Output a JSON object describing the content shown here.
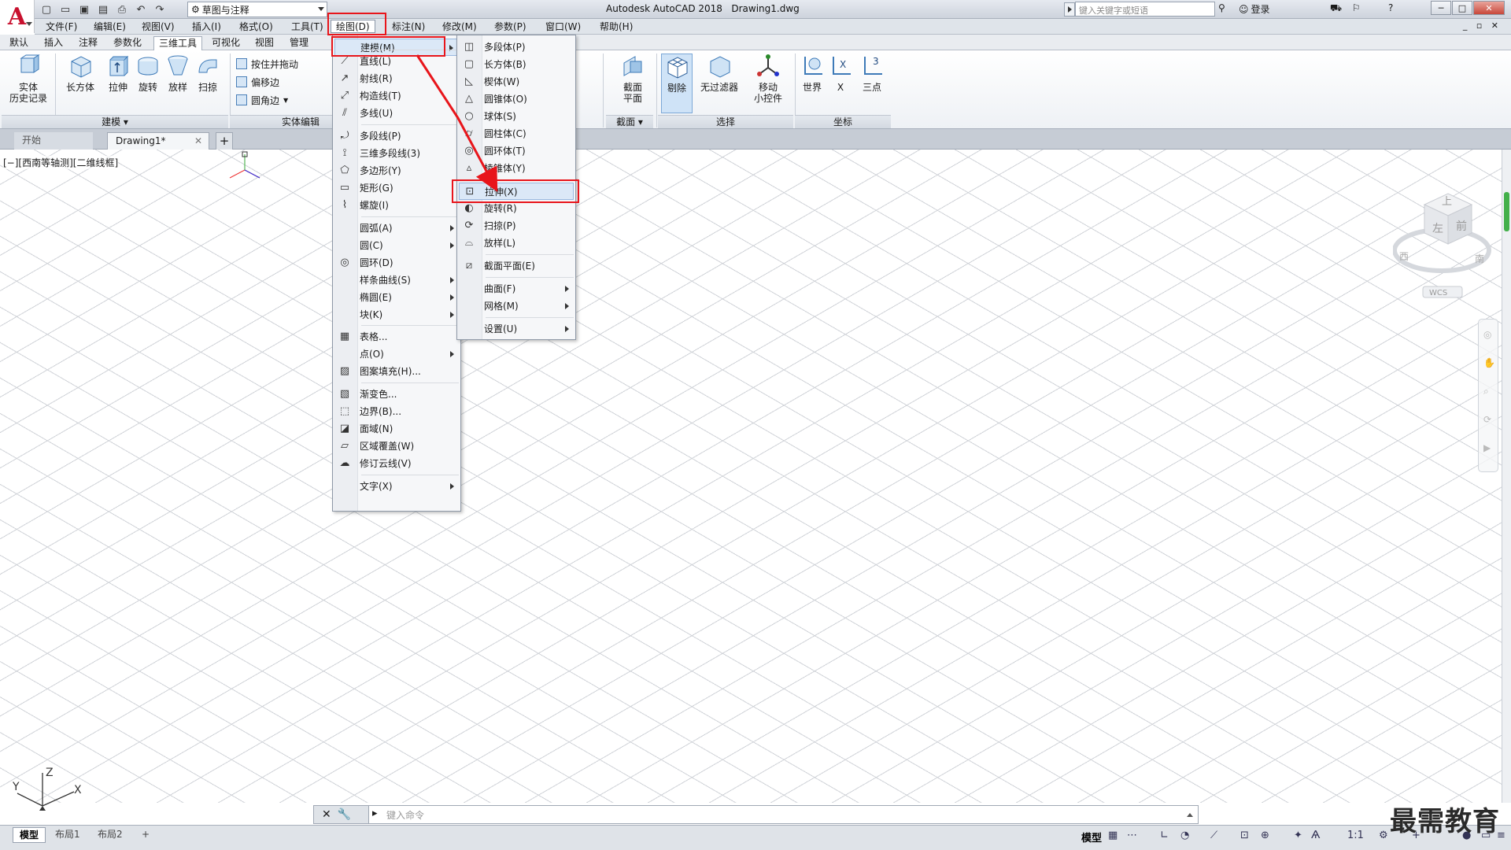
{
  "window": {
    "title": "Autodesk AutoCAD 2018",
    "filename": "Drawing1.dwg"
  },
  "workspace": {
    "selected": "草图与注释"
  },
  "search": {
    "placeholder": "键入关键字或短语"
  },
  "signin": {
    "label": "登录"
  },
  "menubar": [
    "文件(F)",
    "编辑(E)",
    "视图(V)",
    "插入(I)",
    "格式(O)",
    "工具(T)",
    "绘图(D)",
    "标注(N)",
    "修改(M)",
    "参数(P)",
    "窗口(W)",
    "帮助(H)"
  ],
  "ribbon_tabs": [
    "默认",
    "插入",
    "注释",
    "参数化",
    "三维工具",
    "可视化",
    "视图",
    "管理"
  ],
  "ribbon": {
    "history": "实体\n历史记录",
    "modeling": [
      "长方体",
      "拉伸",
      "旋转",
      "放样",
      "扫掠"
    ],
    "solid_edit_small": [
      "按住并拖动",
      "偏移边",
      "圆角边"
    ],
    "panel_modeling": "建模",
    "panel_solid_edit": "实体编辑",
    "section_plane": "截面\n平面",
    "panel_section": "截面",
    "select": [
      "剔除",
      "无过滤器",
      "移动\n小控件"
    ],
    "panel_select": "选择",
    "coords": [
      "世界",
      "X",
      "三点"
    ],
    "panel_coords": "坐标"
  },
  "file_tabs": {
    "start": "开始",
    "drawing": "Drawing1*",
    "plus": "+"
  },
  "viewport_label": "[−][西南等轴测][二维线框]",
  "draw_menu": {
    "items": [
      {
        "label": "建模(M)",
        "icon": "",
        "sub": true
      },
      {
        "label": "直线(L)",
        "icon": "line-icon"
      },
      {
        "label": "射线(R)",
        "icon": "ray-icon"
      },
      {
        "label": "构造线(T)",
        "icon": "xline-icon"
      },
      {
        "label": "多线(U)",
        "icon": "mline-icon"
      },
      {
        "label": "多段线(P)",
        "icon": "polyline-icon"
      },
      {
        "label": "三维多段线(3)",
        "icon": "3dpoly-icon"
      },
      {
        "label": "多边形(Y)",
        "icon": "polygon-icon"
      },
      {
        "label": "矩形(G)",
        "icon": "rectangle-icon"
      },
      {
        "label": "螺旋(I)",
        "icon": "helix-icon"
      },
      {
        "label": "圆弧(A)",
        "icon": "",
        "sub": true
      },
      {
        "label": "圆(C)",
        "icon": "",
        "sub": true
      },
      {
        "label": "圆环(D)",
        "icon": "donut-icon"
      },
      {
        "label": "样条曲线(S)",
        "icon": "",
        "sub": true
      },
      {
        "label": "椭圆(E)",
        "icon": "",
        "sub": true
      },
      {
        "label": "块(K)",
        "icon": "",
        "sub": true
      },
      {
        "label": "表格...",
        "icon": "table-icon"
      },
      {
        "label": "点(O)",
        "icon": "",
        "sub": true
      },
      {
        "label": "图案填充(H)...",
        "icon": "hatch-icon"
      },
      {
        "label": "渐变色...",
        "icon": "gradient-icon"
      },
      {
        "label": "边界(B)...",
        "icon": "boundary-icon"
      },
      {
        "label": "面域(N)",
        "icon": "region-icon"
      },
      {
        "label": "区域覆盖(W)",
        "icon": "wipeout-icon"
      },
      {
        "label": "修订云线(V)",
        "icon": "revcloud-icon"
      },
      {
        "label": "文字(X)",
        "icon": "",
        "sub": true
      }
    ]
  },
  "modeling_menu": {
    "items": [
      {
        "label": "多段体(P)",
        "icon": "polysolid-icon"
      },
      {
        "label": "长方体(B)",
        "icon": "box-icon"
      },
      {
        "label": "楔体(W)",
        "icon": "wedge-icon"
      },
      {
        "label": "圆锥体(O)",
        "icon": "cone-icon"
      },
      {
        "label": "球体(S)",
        "icon": "sphere-icon"
      },
      {
        "label": "圆柱体(C)",
        "icon": "cylinder-icon"
      },
      {
        "label": "圆环体(T)",
        "icon": "torus-icon"
      },
      {
        "label": "棱锥体(Y)",
        "icon": "pyramid-icon"
      },
      {
        "label": "拉伸(X)",
        "icon": "extrude-icon"
      },
      {
        "label": "旋转(R)",
        "icon": "revolve-icon"
      },
      {
        "label": "扫掠(P)",
        "icon": "sweep-icon"
      },
      {
        "label": "放样(L)",
        "icon": "loft-icon"
      },
      {
        "label": "截面平面(E)",
        "icon": "section-icon"
      },
      {
        "label": "曲面(F)",
        "icon": "",
        "sub": true
      },
      {
        "label": "网格(M)",
        "icon": "",
        "sub": true
      },
      {
        "label": "设置(U)",
        "icon": "",
        "sub": true
      }
    ]
  },
  "viewcube": {
    "top": "上",
    "front": "前",
    "left": "左",
    "west": "西",
    "south": "南",
    "wcs": "WCS"
  },
  "ucs": {
    "x": "X",
    "y": "Y",
    "z": "Z"
  },
  "command": {
    "placeholder": "键入命令"
  },
  "layout_tabs": [
    "模型",
    "布局1",
    "布局2"
  ],
  "status": {
    "model": "模型",
    "scale": "1:1"
  },
  "watermark": "最需教育",
  "colors": {
    "highlight": "#e8151b",
    "scroll": "#43b04a"
  }
}
